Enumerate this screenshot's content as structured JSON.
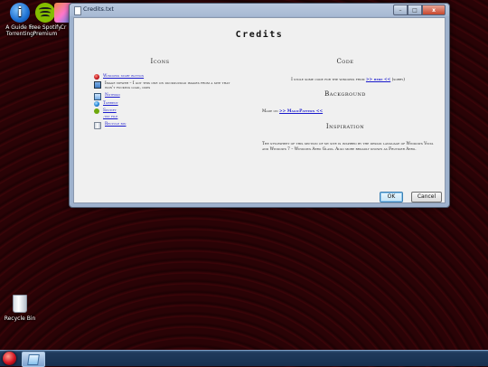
{
  "desktop": {
    "icons": [
      {
        "label": "A Guide to Torrenting",
        "glyph": "i"
      },
      {
        "label": "Free Spotify Premium"
      },
      {
        "label": "Cr"
      }
    ],
    "recycle_bin": {
      "label": "Recycle Bin"
    }
  },
  "window": {
    "title": "Credits.txt",
    "controls": {
      "minimize": "–",
      "maximize": "□",
      "close": "x"
    },
    "heading": "Credits",
    "icons_section": {
      "title": "Icons",
      "rows": [
        {
          "text": "",
          "link": "Windows start button"
        },
        {
          "text": "Image viewer – I got this one on duckduckgo images from a site that won't fucking load, oops",
          "link": ""
        },
        {
          "text": "",
          "link": "Notepad"
        },
        {
          "text": "",
          "link": "Torrent"
        },
        {
          "text": "",
          "link": "Spotify"
        },
        {
          "text": "",
          "link": ".txt file"
        },
        {
          "text": "",
          "link": "Recycle bin"
        }
      ]
    },
    "code_section": {
      "title": "Code",
      "text": "I stole some code for the windows from",
      "link": ">> here <<",
      "after": "(sorry)"
    },
    "background_section": {
      "title": "Background",
      "text": "Made on",
      "link": ">> MagicPattern <<"
    },
    "inspiration_section": {
      "title": "Inspiration",
      "text": "The stylesheet of this section of my site is inspired by the design language of Windows Vista and Windows 7 – Windows Aero Glass. Also more broadly known as Frutiger Aero."
    },
    "buttons": {
      "ok": "OK",
      "cancel": "Cancel"
    }
  },
  "colors": {
    "link": "#1a1acc",
    "desktop_red": "#3d0509",
    "taskbar": "#16304f",
    "titlebar": "#b9c8de"
  }
}
